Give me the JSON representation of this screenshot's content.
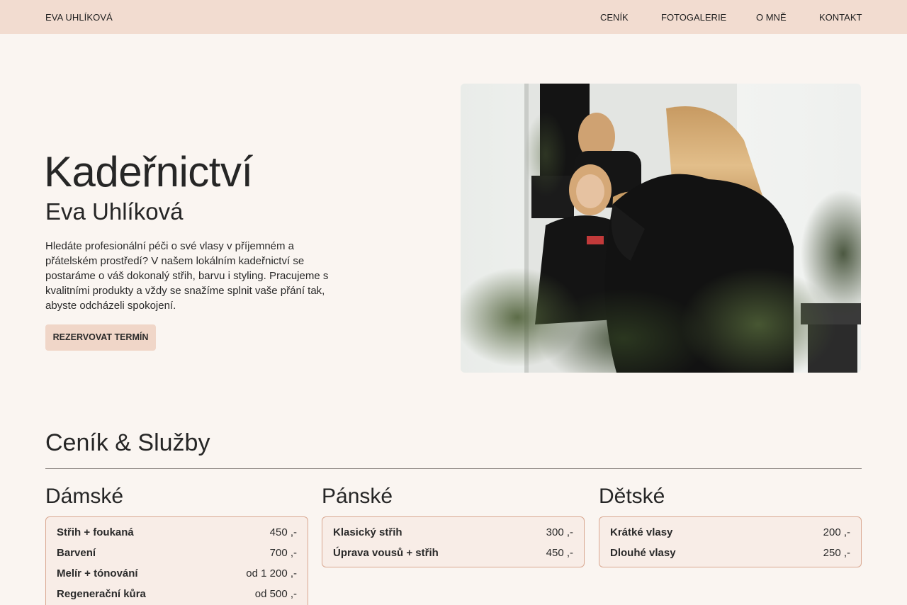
{
  "header": {
    "brand": "EVA UHLÍKOVÁ",
    "nav": [
      "CENÍK",
      "FOTOGALERIE",
      "O MNĚ",
      "KONTAKT"
    ]
  },
  "hero": {
    "title": "Kadeřnictví",
    "subtitle": "Eva Uhlíková",
    "text": "Hledáte profesionální péči o své vlasy v příjemném a přátelském prostředí? V našem lokálním kadeřnictví se postaráme o váš dokonalý střih, barvu i styling. Pracujeme s kvalitními produkty a vždy se snažíme splnit vaše přání tak, abyste odcházeli spokojení.",
    "cta": "REZERVOVAT TERMÍN"
  },
  "pricing": {
    "title": "Ceník & Služby",
    "columns": [
      {
        "title": "Dámské",
        "items": [
          {
            "name": "Střih + foukaná",
            "price": "450 ,-"
          },
          {
            "name": "Barvení",
            "price": "700 ,-"
          },
          {
            "name": "Melír + tónování",
            "price": "od 1 200 ,-"
          },
          {
            "name": "Regenerační kůra",
            "price": "od 500 ,-"
          }
        ]
      },
      {
        "title": "Pánské",
        "items": [
          {
            "name": "Klasický střih",
            "price": "300 ,-"
          },
          {
            "name": "Úprava vousů + střih",
            "price": "450 ,-"
          }
        ]
      },
      {
        "title": "Dětské",
        "items": [
          {
            "name": "Krátké vlasy",
            "price": "200 ,-"
          },
          {
            "name": "Dlouhé vlasy",
            "price": "250 ,-"
          }
        ]
      }
    ]
  },
  "colors": {
    "background": "#faf5f1",
    "header": "#f2dcd0",
    "cta": "#f0d6c8",
    "card_border": "#d9a891",
    "card_bg": "#f8ede7"
  }
}
